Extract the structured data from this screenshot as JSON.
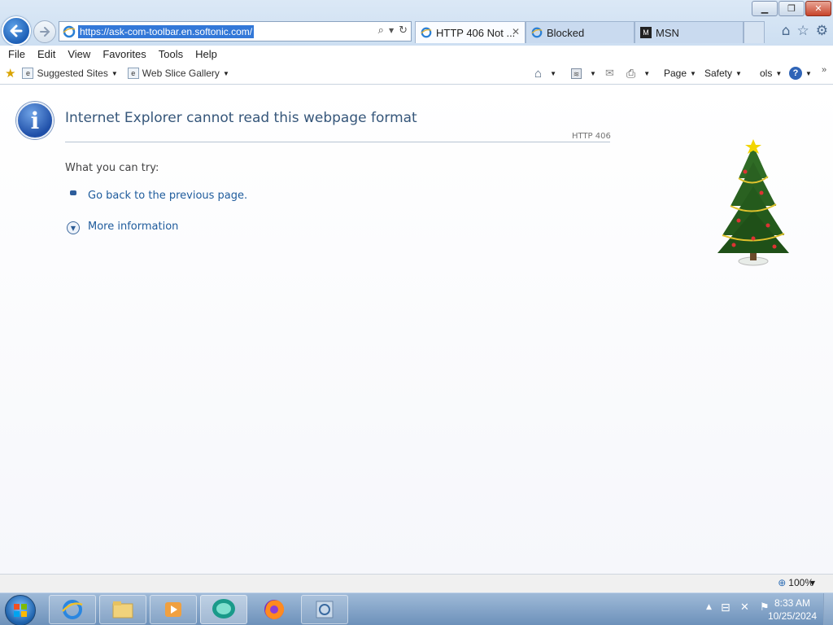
{
  "browser": {
    "url": "https://ask-com-toolbar.en.softonic.com/",
    "tabs": [
      {
        "label": "HTTP 406 Not ...",
        "active": true
      },
      {
        "label": "Blocked",
        "active": false
      },
      {
        "label": "MSN",
        "active": false
      }
    ]
  },
  "menu": [
    "File",
    "Edit",
    "View",
    "Favorites",
    "Tools",
    "Help"
  ],
  "favorites": {
    "items": [
      "Suggested Sites",
      "Web Slice Gallery"
    ]
  },
  "commandbar": {
    "page": "Page",
    "safety": "Safety",
    "tools": "ols"
  },
  "error": {
    "title": "Internet Explorer cannot read this webpage format",
    "code": "HTTP 406",
    "try_heading": "What you can try:",
    "go_back": "Go back to the previous page.",
    "more_info": "More information"
  },
  "statusbar": {
    "zoom": "100%"
  },
  "taskbar": {
    "time": "8:33 AM",
    "date": "10/25/2024"
  },
  "colors": {
    "accent": "#3378d8",
    "link": "#1e5b9c",
    "title": "#35567a"
  }
}
